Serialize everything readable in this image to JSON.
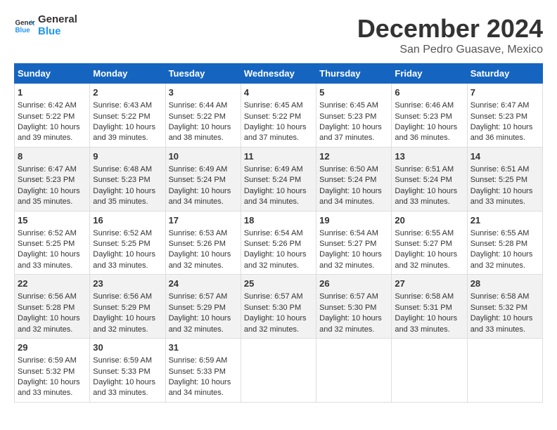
{
  "logo": {
    "text_general": "General",
    "text_blue": "Blue"
  },
  "title": "December 2024",
  "subtitle": "San Pedro Guasave, Mexico",
  "days_of_week": [
    "Sunday",
    "Monday",
    "Tuesday",
    "Wednesday",
    "Thursday",
    "Friday",
    "Saturday"
  ],
  "weeks": [
    [
      {
        "day": "1",
        "info": "Sunrise: 6:42 AM\nSunset: 5:22 PM\nDaylight: 10 hours\nand 39 minutes."
      },
      {
        "day": "2",
        "info": "Sunrise: 6:43 AM\nSunset: 5:22 PM\nDaylight: 10 hours\nand 39 minutes."
      },
      {
        "day": "3",
        "info": "Sunrise: 6:44 AM\nSunset: 5:22 PM\nDaylight: 10 hours\nand 38 minutes."
      },
      {
        "day": "4",
        "info": "Sunrise: 6:45 AM\nSunset: 5:22 PM\nDaylight: 10 hours\nand 37 minutes."
      },
      {
        "day": "5",
        "info": "Sunrise: 6:45 AM\nSunset: 5:23 PM\nDaylight: 10 hours\nand 37 minutes."
      },
      {
        "day": "6",
        "info": "Sunrise: 6:46 AM\nSunset: 5:23 PM\nDaylight: 10 hours\nand 36 minutes."
      },
      {
        "day": "7",
        "info": "Sunrise: 6:47 AM\nSunset: 5:23 PM\nDaylight: 10 hours\nand 36 minutes."
      }
    ],
    [
      {
        "day": "8",
        "info": "Sunrise: 6:47 AM\nSunset: 5:23 PM\nDaylight: 10 hours\nand 35 minutes."
      },
      {
        "day": "9",
        "info": "Sunrise: 6:48 AM\nSunset: 5:23 PM\nDaylight: 10 hours\nand 35 minutes."
      },
      {
        "day": "10",
        "info": "Sunrise: 6:49 AM\nSunset: 5:24 PM\nDaylight: 10 hours\nand 34 minutes."
      },
      {
        "day": "11",
        "info": "Sunrise: 6:49 AM\nSunset: 5:24 PM\nDaylight: 10 hours\nand 34 minutes."
      },
      {
        "day": "12",
        "info": "Sunrise: 6:50 AM\nSunset: 5:24 PM\nDaylight: 10 hours\nand 34 minutes."
      },
      {
        "day": "13",
        "info": "Sunrise: 6:51 AM\nSunset: 5:24 PM\nDaylight: 10 hours\nand 33 minutes."
      },
      {
        "day": "14",
        "info": "Sunrise: 6:51 AM\nSunset: 5:25 PM\nDaylight: 10 hours\nand 33 minutes."
      }
    ],
    [
      {
        "day": "15",
        "info": "Sunrise: 6:52 AM\nSunset: 5:25 PM\nDaylight: 10 hours\nand 33 minutes."
      },
      {
        "day": "16",
        "info": "Sunrise: 6:52 AM\nSunset: 5:25 PM\nDaylight: 10 hours\nand 33 minutes."
      },
      {
        "day": "17",
        "info": "Sunrise: 6:53 AM\nSunset: 5:26 PM\nDaylight: 10 hours\nand 32 minutes."
      },
      {
        "day": "18",
        "info": "Sunrise: 6:54 AM\nSunset: 5:26 PM\nDaylight: 10 hours\nand 32 minutes."
      },
      {
        "day": "19",
        "info": "Sunrise: 6:54 AM\nSunset: 5:27 PM\nDaylight: 10 hours\nand 32 minutes."
      },
      {
        "day": "20",
        "info": "Sunrise: 6:55 AM\nSunset: 5:27 PM\nDaylight: 10 hours\nand 32 minutes."
      },
      {
        "day": "21",
        "info": "Sunrise: 6:55 AM\nSunset: 5:28 PM\nDaylight: 10 hours\nand 32 minutes."
      }
    ],
    [
      {
        "day": "22",
        "info": "Sunrise: 6:56 AM\nSunset: 5:28 PM\nDaylight: 10 hours\nand 32 minutes."
      },
      {
        "day": "23",
        "info": "Sunrise: 6:56 AM\nSunset: 5:29 PM\nDaylight: 10 hours\nand 32 minutes."
      },
      {
        "day": "24",
        "info": "Sunrise: 6:57 AM\nSunset: 5:29 PM\nDaylight: 10 hours\nand 32 minutes."
      },
      {
        "day": "25",
        "info": "Sunrise: 6:57 AM\nSunset: 5:30 PM\nDaylight: 10 hours\nand 32 minutes."
      },
      {
        "day": "26",
        "info": "Sunrise: 6:57 AM\nSunset: 5:30 PM\nDaylight: 10 hours\nand 32 minutes."
      },
      {
        "day": "27",
        "info": "Sunrise: 6:58 AM\nSunset: 5:31 PM\nDaylight: 10 hours\nand 33 minutes."
      },
      {
        "day": "28",
        "info": "Sunrise: 6:58 AM\nSunset: 5:32 PM\nDaylight: 10 hours\nand 33 minutes."
      }
    ],
    [
      {
        "day": "29",
        "info": "Sunrise: 6:59 AM\nSunset: 5:32 PM\nDaylight: 10 hours\nand 33 minutes."
      },
      {
        "day": "30",
        "info": "Sunrise: 6:59 AM\nSunset: 5:33 PM\nDaylight: 10 hours\nand 33 minutes."
      },
      {
        "day": "31",
        "info": "Sunrise: 6:59 AM\nSunset: 5:33 PM\nDaylight: 10 hours\nand 34 minutes."
      },
      {
        "day": "",
        "info": ""
      },
      {
        "day": "",
        "info": ""
      },
      {
        "day": "",
        "info": ""
      },
      {
        "day": "",
        "info": ""
      }
    ]
  ]
}
